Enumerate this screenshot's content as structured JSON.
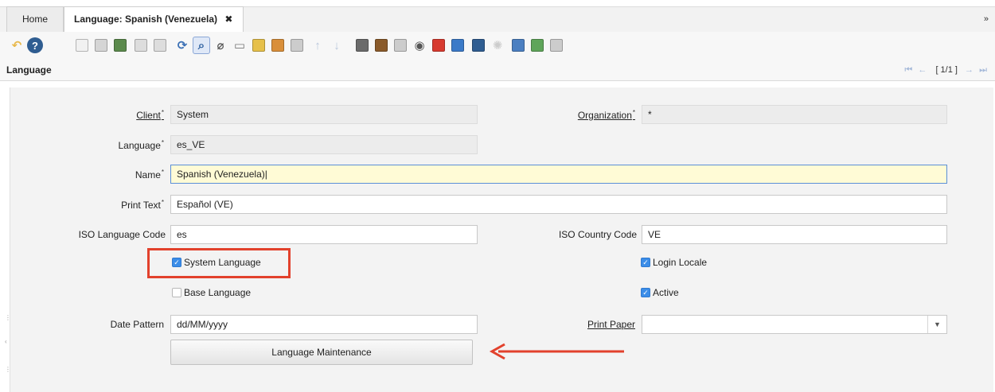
{
  "tabs": {
    "home_label": "Home",
    "active_label": "Language: Spanish (Venezuela)",
    "close_glyph": "✖",
    "collapse_glyph": "»"
  },
  "toolbar": {
    "icons": [
      {
        "name": "undo-icon",
        "glyph": "↶",
        "color": "#e8b84a"
      },
      {
        "name": "help-icon",
        "glyph": "?",
        "color": "#2f5d91"
      },
      {
        "name": "new-record-icon",
        "color": "#f1f1f1"
      },
      {
        "name": "copy-record-icon",
        "color": "#d5d5d5"
      },
      {
        "name": "delete-record-icon",
        "color": "#5b8a4c"
      },
      {
        "name": "save-icon",
        "color": "#dddddd"
      },
      {
        "name": "save-new-icon",
        "color": "#dddddd"
      },
      {
        "name": "refresh-icon",
        "glyph": "⟳",
        "color": "#3a6fb5"
      },
      {
        "name": "find-icon",
        "glyph": "⌕",
        "color": "#2d5f9e"
      },
      {
        "name": "attachment-icon",
        "glyph": "⌀",
        "color": "#555555"
      },
      {
        "name": "chat-icon",
        "glyph": "▭",
        "color": "#777777"
      },
      {
        "name": "history-icon",
        "color": "#e6c04a"
      },
      {
        "name": "grid-toggle-icon",
        "color": "#d98f3a"
      },
      {
        "name": "detail-icon",
        "color": "#cccccc"
      },
      {
        "name": "previous-tab-icon",
        "glyph": "↑",
        "color": "#b9c7dc"
      },
      {
        "name": "next-tab-icon",
        "glyph": "↓",
        "color": "#b9c7dc"
      },
      {
        "name": "report-icon",
        "color": "#6b6b6b"
      },
      {
        "name": "archive-icon",
        "color": "#8a5a2a"
      },
      {
        "name": "print-icon",
        "color": "#cccccc"
      },
      {
        "name": "zoom-across-icon",
        "glyph": "◉",
        "color": "#555555"
      },
      {
        "name": "request-icon",
        "color": "#d73a2f"
      },
      {
        "name": "product-info-icon",
        "color": "#3b7ac8"
      },
      {
        "name": "workflow-icon",
        "color": "#2f5d91"
      },
      {
        "name": "process-icon",
        "glyph": "✺",
        "color": "#cccccc"
      },
      {
        "name": "export-icon",
        "color": "#4b7fc1"
      },
      {
        "name": "import-icon",
        "color": "#5fa55a"
      },
      {
        "name": "customize-icon",
        "color": "#cccccc"
      }
    ]
  },
  "window": {
    "title": "Language",
    "record_indicator": "[ 1/1 ]"
  },
  "form": {
    "client": {
      "label": "Client",
      "value": "System"
    },
    "organization": {
      "label": "Organization",
      "value": "*"
    },
    "language": {
      "label": "Language",
      "value": "es_VE"
    },
    "name": {
      "label": "Name",
      "value": "Spanish (Venezuela)"
    },
    "print_text": {
      "label": "Print Text",
      "value": "Español (VE)"
    },
    "iso_language_code": {
      "label": "ISO Language Code",
      "value": "es"
    },
    "iso_country_code": {
      "label": "ISO Country Code",
      "value": "VE"
    },
    "system_language": {
      "label": "System Language",
      "checked": true
    },
    "login_locale": {
      "label": "Login Locale",
      "checked": true
    },
    "base_language": {
      "label": "Base Language",
      "checked": false
    },
    "active": {
      "label": "Active",
      "checked": true
    },
    "date_pattern": {
      "label": "Date Pattern",
      "value": "dd/MM/yyyy"
    },
    "print_paper": {
      "label": "Print Paper",
      "value": ""
    },
    "mandatory_mark": "*",
    "check_glyph": "✓",
    "dropdown_glyph": "▼",
    "maintenance_button_label": "Language Maintenance"
  },
  "colors": {
    "annotation": "#e2412c",
    "checkbox_on": "#3b8de8",
    "focus_field": "#fffbd6"
  }
}
